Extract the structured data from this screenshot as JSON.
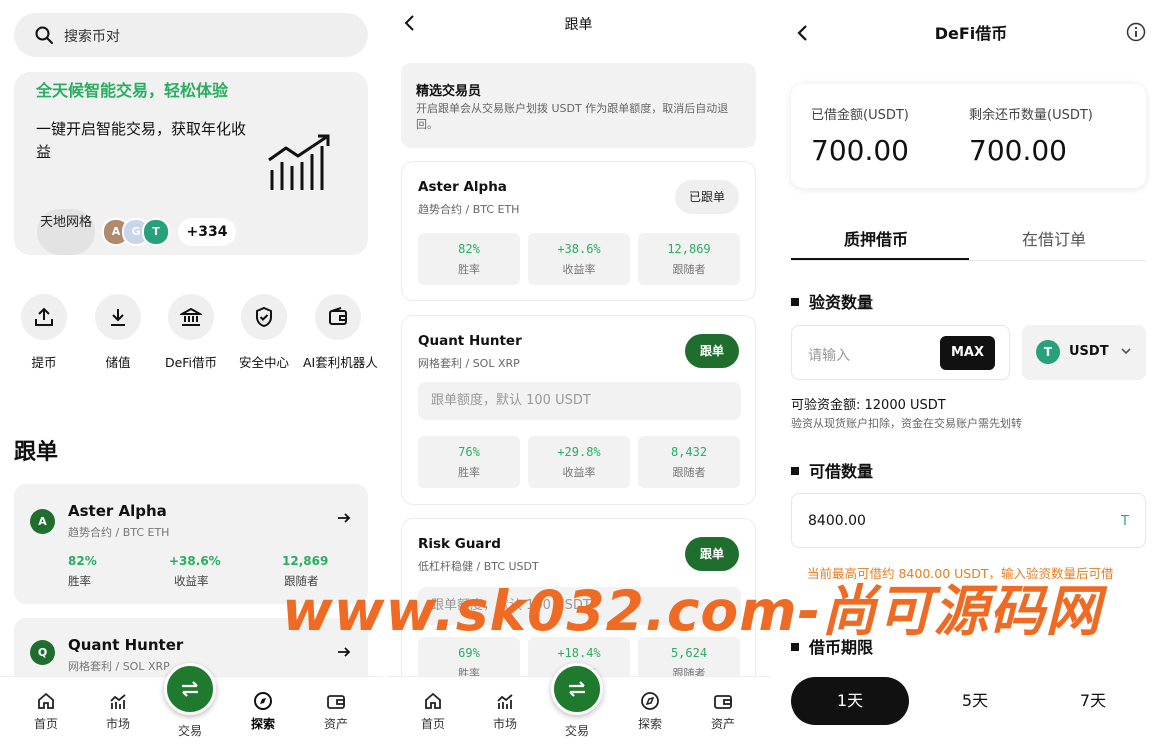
{
  "explore": {
    "search_placeholder": "搜索币对",
    "banner": {
      "headline": "全天候智能交易，轻松体验",
      "description": "一键开启智能交易，获取年化收益",
      "tag": "天地网格",
      "avatars": [
        "A",
        "G",
        "T"
      ],
      "count": "+334"
    },
    "quick_actions": [
      {
        "label": "提币",
        "icon": "upload-icon"
      },
      {
        "label": "储值",
        "icon": "download-icon"
      },
      {
        "label": "DeFi借币",
        "icon": "bank-icon"
      },
      {
        "label": "安全中心",
        "icon": "shield-icon"
      },
      {
        "label": "AI套利机器人",
        "icon": "wallet-icon"
      }
    ],
    "section_title": "跟单",
    "traders": [
      {
        "avatar": "A",
        "name": "Aster Alpha",
        "sub": "趋势合约 / BTC ETH",
        "win": "82%",
        "win_label": "胜率",
        "ret": "+38.6%",
        "ret_label": "收益率",
        "followers": "12,869",
        "followers_label": "跟随者"
      },
      {
        "avatar": "Q",
        "name": "Quant Hunter",
        "sub": "网格套利 / SOL XRP"
      }
    ]
  },
  "nav": [
    {
      "label": "首页",
      "icon": "home-icon"
    },
    {
      "label": "市场",
      "icon": "market-chart-icon"
    },
    {
      "label": "交易",
      "icon": "swap-icon"
    },
    {
      "label": "探索",
      "icon": "compass-icon"
    },
    {
      "label": "资产",
      "icon": "wallet-icon"
    }
  ],
  "copy": {
    "title": "跟单",
    "notice_title": "精选交易员",
    "notice_desc": "开启跟单会从交易账户划拨 USDT 作为跟单额度，取消后自动退回。",
    "amount_placeholder": "跟单额度，默认 100 USDT",
    "traders": [
      {
        "name": "Aster Alpha",
        "sub": "趋势合约 / BTC ETH",
        "button": "已跟单",
        "following": true,
        "win": "82%",
        "ret": "+38.6%",
        "followers": "12,869"
      },
      {
        "name": "Quant Hunter",
        "sub": "网格套利 / SOL XRP",
        "button": "跟单",
        "following": false,
        "win": "76%",
        "ret": "+29.8%",
        "followers": "8,432"
      },
      {
        "name": "Risk Guard",
        "sub": "低杠杆稳健 / BTC USDT",
        "button": "跟单",
        "following": false,
        "win": "69%",
        "ret": "+18.4%",
        "followers": "5,624"
      }
    ],
    "labels": {
      "win": "胜率",
      "ret": "收益率",
      "followers": "跟随者"
    }
  },
  "defi": {
    "title": "DeFi借币",
    "borrowed_label": "已借金额(USDT)",
    "borrowed_value": "700.00",
    "remaining_label": "剩余还币数量(USDT)",
    "remaining_value": "700.00",
    "tabs": [
      "质押借币",
      "在借订单"
    ],
    "verify_title": "验资数量",
    "verify_placeholder": "请输入",
    "max_label": "MAX",
    "coin_icon": "T",
    "coin": "USDT",
    "balance": "可验资金额: 12000 USDT",
    "balance_note": "验资从现货账户扣除，资金在交易账户需先划转",
    "borrow_title": "可借数量",
    "borrow_value": "8400.00",
    "borrow_unit": "T",
    "warning": "当前最高可借约 8400.00 USDT，输入验资数量后可借",
    "period_title": "借币期限",
    "periods": [
      "1天",
      "5天",
      "7天"
    ]
  },
  "watermark": "www.sk032.com-尚可源码网"
}
